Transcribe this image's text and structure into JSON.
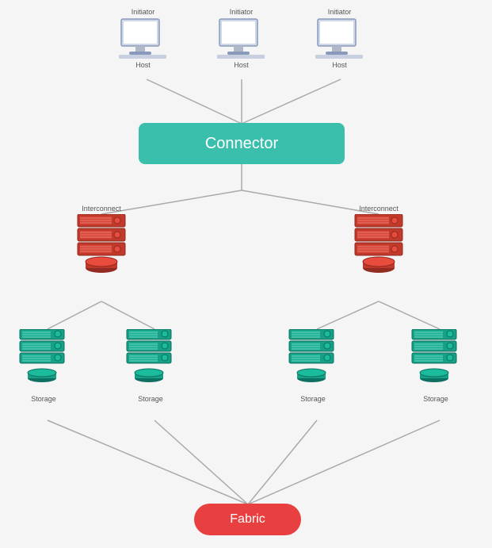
{
  "connector": {
    "label": "Connector"
  },
  "fabric": {
    "label": "Fabric"
  },
  "computers": [
    {
      "id": "comp1",
      "top_label": "Initiator",
      "bottom_label": "Host"
    },
    {
      "id": "comp2",
      "top_label": "Initiator",
      "bottom_label": "Host"
    },
    {
      "id": "comp3",
      "top_label": "Initiator",
      "bottom_label": "Host"
    }
  ],
  "red_servers": [
    {
      "id": "rs1",
      "top_label": "Interconnect",
      "bottom_label": ""
    },
    {
      "id": "rs2",
      "top_label": "Interconnect",
      "bottom_label": ""
    }
  ],
  "teal_servers": [
    {
      "id": "ts1",
      "bottom_label": "Storage"
    },
    {
      "id": "ts2",
      "bottom_label": "Storage"
    },
    {
      "id": "ts3",
      "bottom_label": "Storage"
    },
    {
      "id": "ts4",
      "bottom_label": "Storage"
    }
  ]
}
